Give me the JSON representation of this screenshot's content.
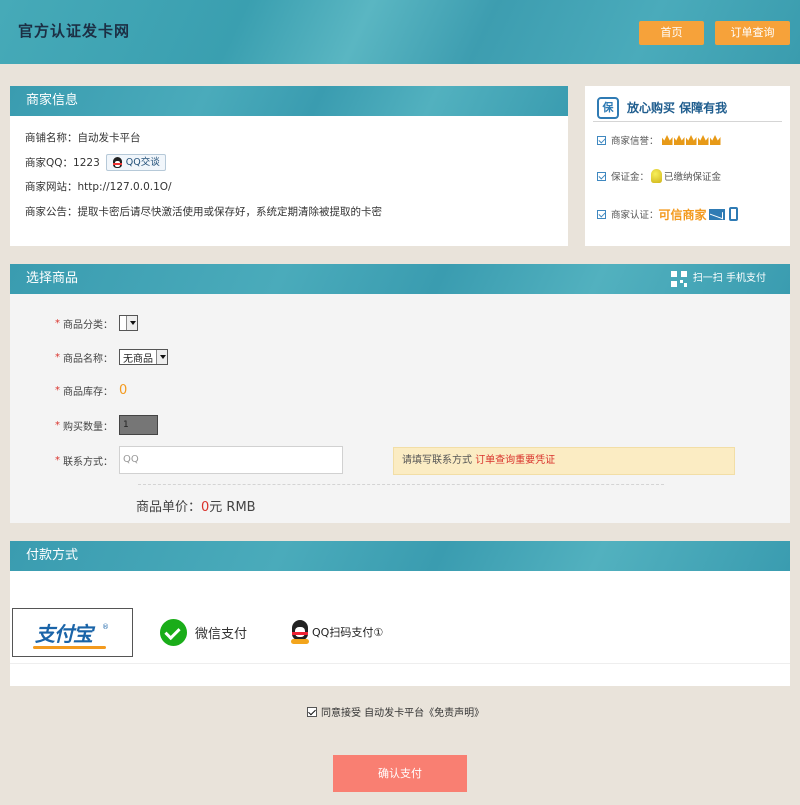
{
  "header": {
    "logo_text": "官方认证发卡网",
    "home_label": "首页",
    "order_query_label": "订单查询"
  },
  "merchant": {
    "title": "商家信息",
    "shop_name_label": "商铺名称：",
    "shop_name": "自动发卡平台",
    "qq_label": "商家QQ：",
    "qq": "1223",
    "qq_chat_label": "QQ交谈",
    "website_label": "商家网站：",
    "website": "http://127.0.0.1O/",
    "notice_label": "商家公告：",
    "notice": "提取卡密后请尽快激活使用或保存好，系统定期清除被提取的卡密"
  },
  "trust": {
    "title": "放心购买   保障有我",
    "badge_text": "保",
    "reputation_label": "商家信誉：",
    "reputation_crowns": 5,
    "deposit_label": "保证金：",
    "deposit_value": "已缴纳保证金",
    "certification_label": "商家认证：",
    "certification_value": "可信商家",
    "icons": [
      "check-icon",
      "crown-icon",
      "bulb-icon",
      "envelope-icon",
      "phone-icon",
      "shield-badge-icon"
    ]
  },
  "select_goods": {
    "title": "选择商品",
    "scan_label": "扫一扫 手机支付",
    "category_label": "商品分类：",
    "category_value": "",
    "name_label": "商品名称：",
    "name_value": "无商品",
    "stock_label": "商品库存：",
    "stock_value": "0",
    "quantity_label": "购买数量：",
    "quantity_value": "1",
    "contact_label": "联系方式：",
    "contact_placeholder": "QQ",
    "hint_text": "请填写联系方式 ",
    "hint_highlight": "订单查询重要凭证",
    "price_label": "商品单价：",
    "price_value": "0",
    "price_unit": "元 RMB"
  },
  "payment": {
    "title": "付款方式",
    "alipay_label": "支付宝",
    "alipay_tm": "®",
    "wechat_label": "微信支付",
    "qq_label": "QQ扫码支付①"
  },
  "footer": {
    "agree_text": "同意接受 自动发卡平台《免责声明》",
    "agree_checked": true,
    "confirm_label": "确认支付"
  },
  "colors": {
    "teal": "#3a9cb0",
    "orange_button": "#f6a23a",
    "confirm_button": "#f97f72",
    "accent_red": "#d9322b",
    "stock_orange": "#f39a1e"
  }
}
